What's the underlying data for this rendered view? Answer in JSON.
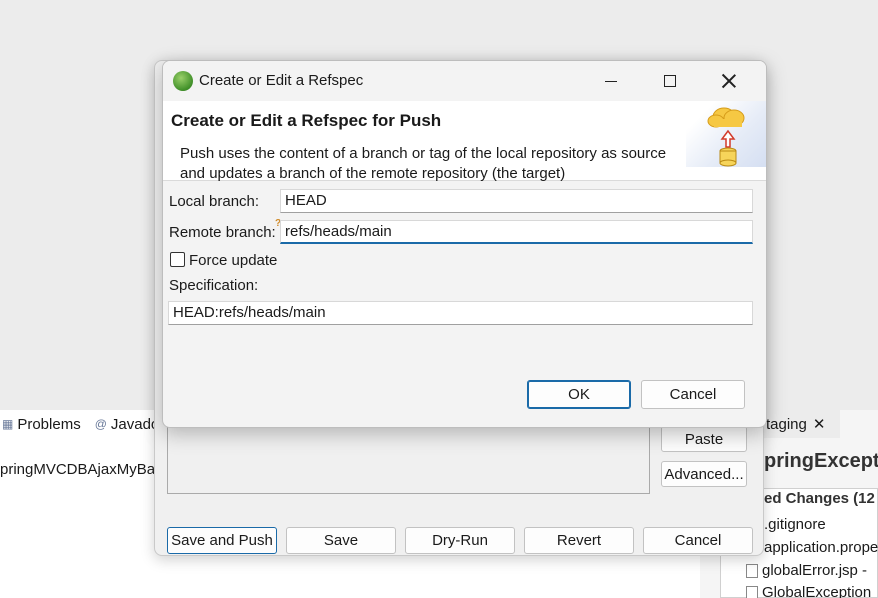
{
  "ide": {
    "tabs": [
      {
        "label": "Problems",
        "icon": "problems-icon"
      },
      {
        "label": "Javado",
        "icon": "at-icon"
      }
    ],
    "project_text": "pringMVCDBAjaxMyBa",
    "staging": {
      "tab_label": "taging",
      "title": "pringExcept",
      "section": "ed Changes (12",
      "files": [
        ".gitignore",
        "application.prope",
        "globalError.jsp -",
        "GlobalException"
      ]
    }
  },
  "parent_dialog": {
    "side_buttons": {
      "paste": "Paste",
      "advanced": "Advanced..."
    },
    "bottom_buttons": {
      "save_and_push": "Save and Push",
      "save": "Save",
      "dry_run": "Dry-Run",
      "revert": "Revert",
      "cancel": "Cancel"
    }
  },
  "dialog": {
    "window_title": "Create or Edit a Refspec",
    "heading": "Create or Edit a Refspec for Push",
    "description": "Push uses the content of a branch or tag of the local repository as source and updates a branch of the remote repository (the target)",
    "local_branch": {
      "label": "Local branch:",
      "value": "HEAD"
    },
    "remote_branch": {
      "label": "Remote branch:",
      "value": "refs/heads/main"
    },
    "force_update": {
      "label": "Force update",
      "checked": false
    },
    "specification": {
      "label": "Specification:",
      "value": "HEAD:refs/heads/main"
    },
    "buttons": {
      "ok": "OK",
      "cancel": "Cancel"
    }
  },
  "colors": {
    "accent": "#1a6aa8",
    "background": "#ececec"
  }
}
